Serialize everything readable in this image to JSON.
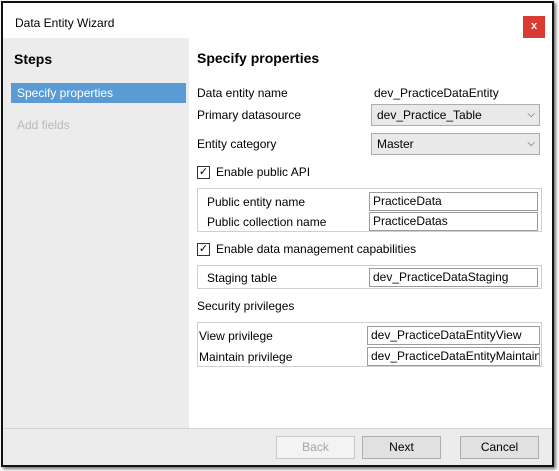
{
  "window": {
    "title": "Data Entity Wizard",
    "close_label": "x"
  },
  "steps": {
    "title": "Steps",
    "items": [
      {
        "label": "Specify properties",
        "state": "active"
      },
      {
        "label": "Add fields",
        "state": "disabled"
      }
    ]
  },
  "main": {
    "heading": "Specify properties",
    "data_entity_name": {
      "label": "Data entity name",
      "value": "dev_PracticeDataEntity"
    },
    "primary_datasource": {
      "label": "Primary datasource",
      "value": "dev_Practice_Table"
    },
    "entity_category": {
      "label": "Entity category",
      "value": "Master"
    },
    "enable_public_api": {
      "label": "Enable public API",
      "checked": true,
      "mark": "✓"
    },
    "public_entity_name": {
      "label": "Public entity name",
      "value": "PracticeData"
    },
    "public_collection_name": {
      "label": "Public collection name",
      "value": "PracticeDatas"
    },
    "enable_data_mgmt": {
      "label": "Enable data management capabilities",
      "checked": true,
      "mark": "✓"
    },
    "staging_table": {
      "label": "Staging table",
      "value": "dev_PracticeDataStaging"
    },
    "security_privileges": {
      "label": "Security privileges"
    },
    "view_privilege": {
      "label": "View privilege",
      "value": "dev_PracticeDataEntityView"
    },
    "maintain_privilege": {
      "label": "Maintain privilege",
      "value": "dev_PracticeDataEntityMaintain"
    }
  },
  "footer": {
    "back_label": "Back",
    "next_label": "Next",
    "cancel_label": "Cancel"
  },
  "colors": {
    "active_step": "#5b9bd5",
    "close_button": "#d93b33",
    "pane_bg": "#ececec"
  },
  "icons": {
    "dropdown": "chevron-down-icon",
    "checkbox": "checkmark-icon"
  }
}
